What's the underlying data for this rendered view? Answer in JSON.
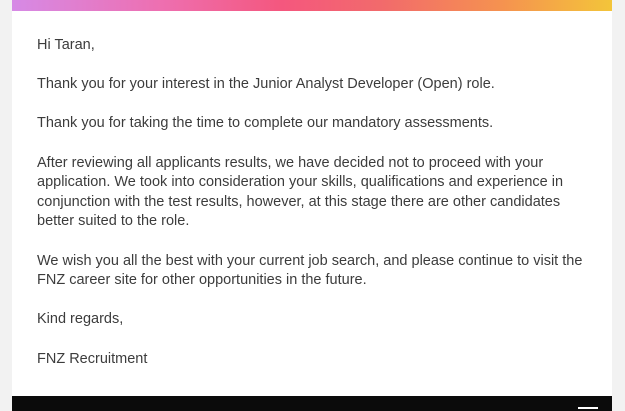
{
  "email": {
    "greeting": "Hi Taran,",
    "paragraphs": [
      "Thank you for your interest in the Junior Analyst Developer (Open) role.",
      "Thank you for taking the time to complete our mandatory assessments.",
      "After reviewing all applicants results, we have decided not to proceed with your application. We took into consideration your skills, qualifications and experience in conjunction with the test results, however, at this stage there are other candidates better suited to the role.",
      "We wish you all the best with your current job search, and please continue to visit the FNZ career site for other opportunities in the future."
    ],
    "closing": "Kind regards,",
    "signature": "FNZ Recruitment"
  },
  "footer": {
    "menu_icon": "menu-icon"
  },
  "colors": {
    "background": "#f2f2f2",
    "card": "#ffffff",
    "text": "#3c3c3c",
    "footer": "#0b0b0b",
    "gradient": [
      "#d68ae6",
      "#ee6fb0",
      "#f4577e",
      "#f26b6b",
      "#f5934f",
      "#f3c53a"
    ]
  }
}
